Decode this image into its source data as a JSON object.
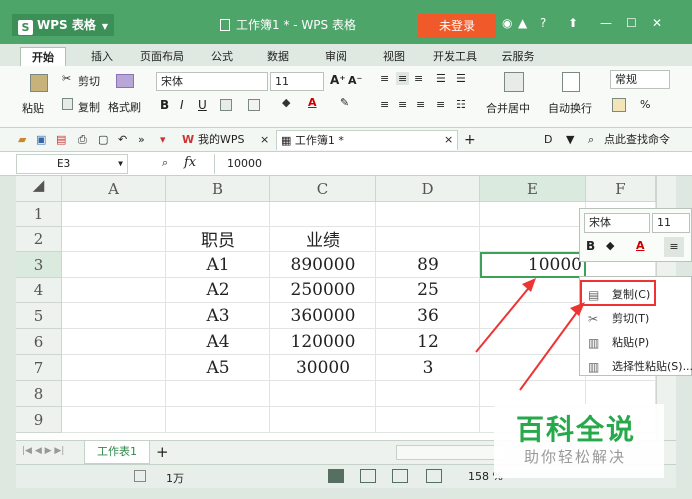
{
  "titlebar": {
    "app_name": "WPS 表格",
    "doc_title": "工作簿1 * - WPS 表格",
    "login": "未登录",
    "help": "?"
  },
  "ribbon_tabs": [
    "开始",
    "插入",
    "页面布局",
    "公式",
    "数据",
    "审阅",
    "视图",
    "开发工具",
    "云服务"
  ],
  "ribbon": {
    "paste": "粘贴",
    "cut": "剪切",
    "copy": "复制",
    "format_painter": "格式刷",
    "font_name": "宋体",
    "font_size": "11",
    "merge_center": "合并居中",
    "auto_wrap": "自动换行",
    "number_format": "常规",
    "percent": "%"
  },
  "doc_tabs": {
    "my_wps": "我的WPS",
    "workbook": "工作簿1 *",
    "search": "点此查找命令"
  },
  "formula_bar": {
    "name_box": "E3",
    "fx": "fx",
    "value": "10000"
  },
  "columns": [
    "A",
    "B",
    "C",
    "D",
    "E",
    "F"
  ],
  "rows": [
    "1",
    "2",
    "3",
    "4",
    "5",
    "6",
    "7",
    "8",
    "9"
  ],
  "table": {
    "header": [
      "职员",
      "业绩"
    ],
    "data": [
      [
        "A1",
        "890000",
        "89"
      ],
      [
        "A2",
        "250000",
        "25"
      ],
      [
        "A3",
        "360000",
        "36"
      ],
      [
        "A4",
        "120000",
        "12"
      ],
      [
        "A5",
        "30000",
        "3"
      ]
    ],
    "e3": "10000"
  },
  "sheet_tab": "工作表1",
  "status": {
    "count": "1万",
    "zoom": "158 %"
  },
  "mini_toolbar": {
    "font": "宋体",
    "size": "11",
    "bold": "B"
  },
  "context_menu": [
    "复制(C)",
    "剪切(T)",
    "粘贴(P)",
    "选择性粘贴(S)..."
  ],
  "watermark": {
    "title": "百科全说",
    "subtitle": "助你轻松解决"
  },
  "colors": {
    "title_green": "#4da56a",
    "login_orange": "#f05a2a",
    "annotation_red": "#e33"
  }
}
